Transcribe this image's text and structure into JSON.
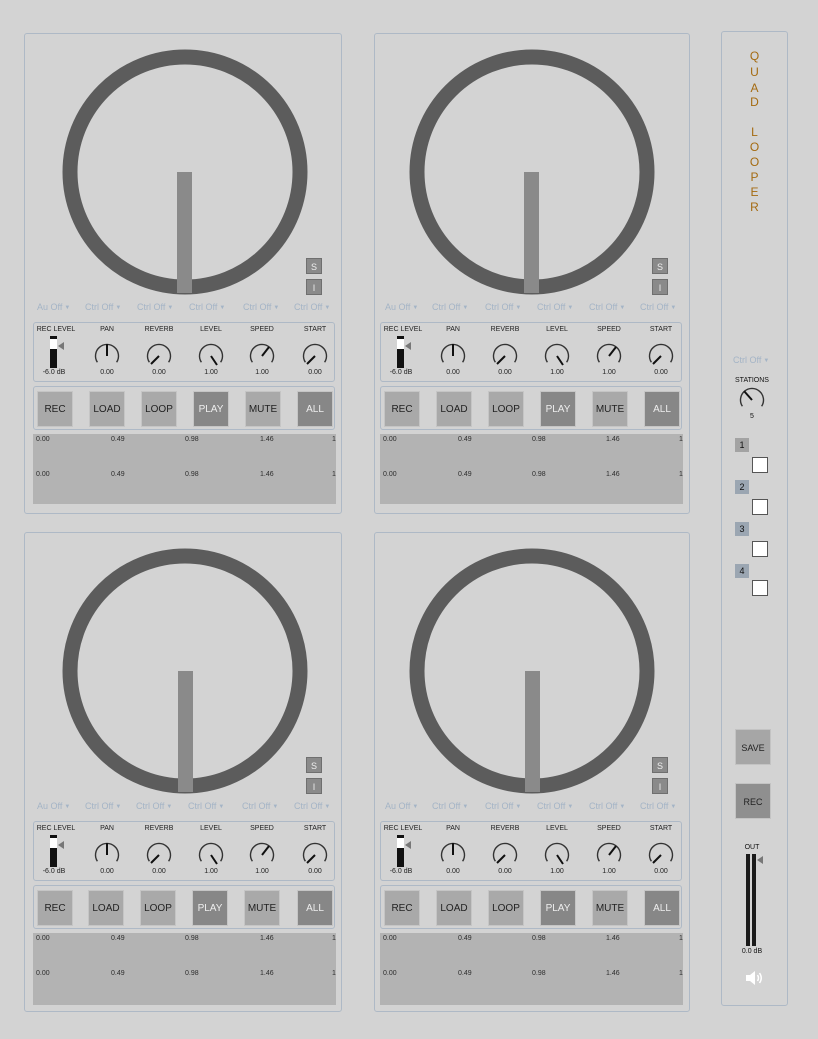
{
  "app": {
    "title_letters": [
      "Q",
      "U",
      "A",
      "D",
      "",
      "L",
      "O",
      "O",
      "P",
      "E",
      "R"
    ]
  },
  "colors": {
    "background": "#d3d3d3",
    "panel_border": "#aeb9c6",
    "disc": "#5c5c5c",
    "hand": "#8a8a8a",
    "title": "#a46a10",
    "ctrl_text": "#a4b4c6"
  },
  "loopers": [
    {
      "solo_label": "S",
      "input_label": "I",
      "dropdowns": [
        "Au Off",
        "Ctrl Off",
        "Ctrl Off",
        "Ctrl Off",
        "Ctrl Off",
        "Ctrl Off"
      ],
      "knobs": [
        {
          "label": "REC LEVEL",
          "value": "-6.0 dB"
        },
        {
          "label": "PAN",
          "value": "0.00"
        },
        {
          "label": "REVERB",
          "value": "0.00"
        },
        {
          "label": "LEVEL",
          "value": "1.00"
        },
        {
          "label": "SPEED",
          "value": "1.00"
        },
        {
          "label": "START",
          "value": "0.00"
        }
      ],
      "buttons": [
        "REC",
        "LOAD",
        "LOOP",
        "PLAY",
        "MUTE",
        "ALL"
      ],
      "wave_ticks": [
        "0.00",
        "0.49",
        "0.98",
        "1.46",
        "1"
      ]
    },
    {
      "solo_label": "S",
      "input_label": "I",
      "dropdowns": [
        "Au Off",
        "Ctrl Off",
        "Ctrl Off",
        "Ctrl Off",
        "Ctrl Off",
        "Ctrl Off"
      ],
      "knobs": [
        {
          "label": "REC LEVEL",
          "value": "-6.0 dB"
        },
        {
          "label": "PAN",
          "value": "0.00"
        },
        {
          "label": "REVERB",
          "value": "0.00"
        },
        {
          "label": "LEVEL",
          "value": "1.00"
        },
        {
          "label": "SPEED",
          "value": "1.00"
        },
        {
          "label": "START",
          "value": "0.00"
        }
      ],
      "buttons": [
        "REC",
        "LOAD",
        "LOOP",
        "PLAY",
        "MUTE",
        "ALL"
      ],
      "wave_ticks": [
        "0.00",
        "0.49",
        "0.98",
        "1.46",
        "1"
      ]
    },
    {
      "solo_label": "S",
      "input_label": "I",
      "dropdowns": [
        "Au Off",
        "Ctrl Off",
        "Ctrl Off",
        "Ctrl Off",
        "Ctrl Off",
        "Ctrl Off"
      ],
      "knobs": [
        {
          "label": "REC LEVEL",
          "value": "-6.0 dB"
        },
        {
          "label": "PAN",
          "value": "0.00"
        },
        {
          "label": "REVERB",
          "value": "0.00"
        },
        {
          "label": "LEVEL",
          "value": "1.00"
        },
        {
          "label": "SPEED",
          "value": "1.00"
        },
        {
          "label": "START",
          "value": "0.00"
        }
      ],
      "buttons": [
        "REC",
        "LOAD",
        "LOOP",
        "PLAY",
        "MUTE",
        "ALL"
      ],
      "wave_ticks": [
        "0.00",
        "0.49",
        "0.98",
        "1.46",
        "1"
      ]
    },
    {
      "solo_label": "S",
      "input_label": "I",
      "dropdowns": [
        "Au Off",
        "Ctrl Off",
        "Ctrl Off",
        "Ctrl Off",
        "Ctrl Off",
        "Ctrl Off"
      ],
      "knobs": [
        {
          "label": "REC LEVEL",
          "value": "-6.0 dB"
        },
        {
          "label": "PAN",
          "value": "0.00"
        },
        {
          "label": "REVERB",
          "value": "0.00"
        },
        {
          "label": "LEVEL",
          "value": "1.00"
        },
        {
          "label": "SPEED",
          "value": "1.00"
        },
        {
          "label": "START",
          "value": "0.00"
        }
      ],
      "buttons": [
        "REC",
        "LOAD",
        "LOOP",
        "PLAY",
        "MUTE",
        "ALL"
      ],
      "wave_ticks": [
        "0.00",
        "0.49",
        "0.98",
        "1.46",
        "1"
      ]
    }
  ],
  "sidebar": {
    "ctrl_dropdown": "Ctrl Off",
    "stations_label": "STATIONS",
    "stations_value": "5",
    "stations": [
      "1",
      "2",
      "3",
      "4"
    ],
    "save_label": "SAVE",
    "rec_label": "REC",
    "out_label": "OUT",
    "out_value": "0.0 dB",
    "speaker_icon": "speaker-icon"
  }
}
